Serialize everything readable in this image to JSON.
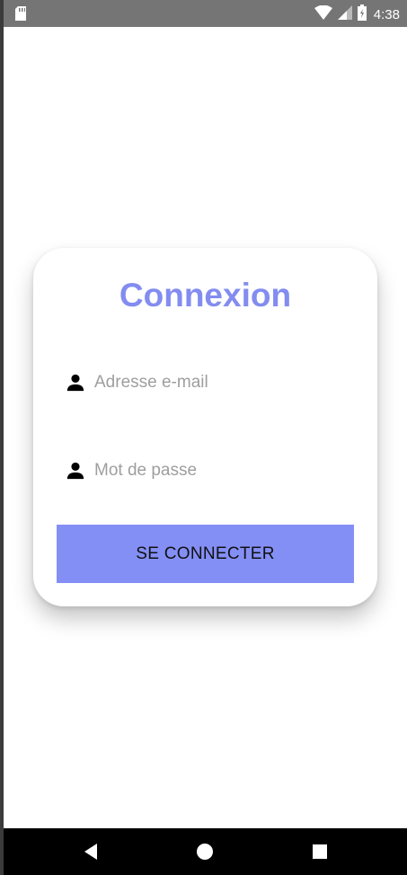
{
  "status_bar": {
    "time": "4:38",
    "icons": [
      "sd-card-icon",
      "wifi-icon",
      "signal-icon",
      "battery-icon"
    ]
  },
  "login": {
    "title": "Connexion",
    "email_placeholder": "Adresse e-mail",
    "password_placeholder": "Mot de passe",
    "submit_label": "SE CONNECTER"
  },
  "nav_bar": {
    "icons": [
      "back-icon",
      "home-icon",
      "recent-apps-icon"
    ]
  },
  "colors": {
    "accent": "#838cf0",
    "button": "#848ff6",
    "status_bar": "#757575"
  }
}
